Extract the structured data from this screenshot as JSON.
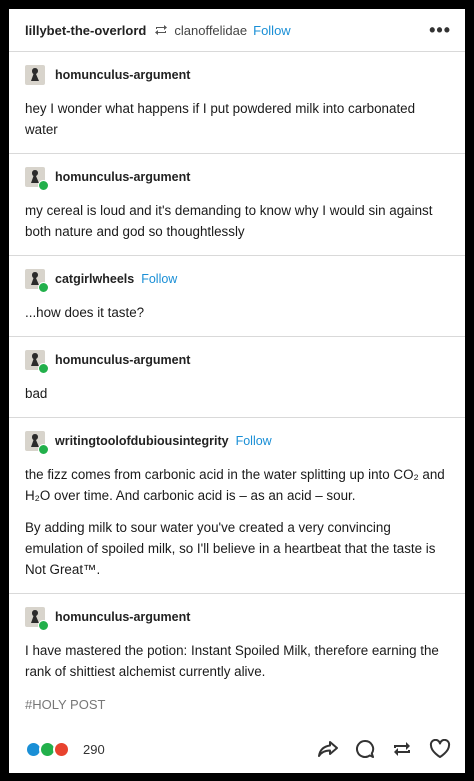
{
  "header": {
    "blog_name": "lillybet-the-overlord",
    "reblogged_from": "clanoffelidae",
    "follow_label": "Follow",
    "more_icon": "more-horizontal-icon"
  },
  "posts": [
    {
      "author": "homunculus-argument",
      "follow": "",
      "paragraphs": [
        "hey I wonder what happens if I put powdered milk into carbonated water"
      ]
    },
    {
      "author": "homunculus-argument",
      "follow": "",
      "paragraphs": [
        "my cereal is loud and it's demanding to know why I would sin against both nature and god so thoughtlessly"
      ]
    },
    {
      "author": "catgirlwheels",
      "follow": "Follow",
      "paragraphs": [
        "...how does it taste?"
      ]
    },
    {
      "author": "homunculus-argument",
      "follow": "",
      "paragraphs": [
        "bad"
      ]
    },
    {
      "author": "writingtoolofdubiousintegrity",
      "follow": "Follow",
      "paragraphs": [
        "the fizz comes from carbonic acid in the water splitting up into CO₂ and H₂O over time. And carbonic acid is – as an acid – sour.",
        "By adding milk to sour water you've created a very convincing emulation of spoiled milk, so I'll believe in a heartbeat that the taste is Not Great™."
      ]
    },
    {
      "author": "homunculus-argument",
      "follow": "",
      "paragraphs": [
        "I have mastered the potion: Instant Spoiled Milk, therefore earning the rank of shittiest alchemist currently alive."
      ]
    }
  ],
  "tags": [
    "#HOLY POST"
  ],
  "footer": {
    "notes_count": "290",
    "note_colors": [
      "#1a8fd6",
      "#22b04b",
      "#e8432e"
    ],
    "actions": [
      "share-icon",
      "reply-icon",
      "reblog-icon",
      "like-icon"
    ]
  },
  "colors": {
    "accent": "#1a8fd6",
    "badge": "#22b04b",
    "background": "#000000",
    "card": "#ffffff"
  }
}
